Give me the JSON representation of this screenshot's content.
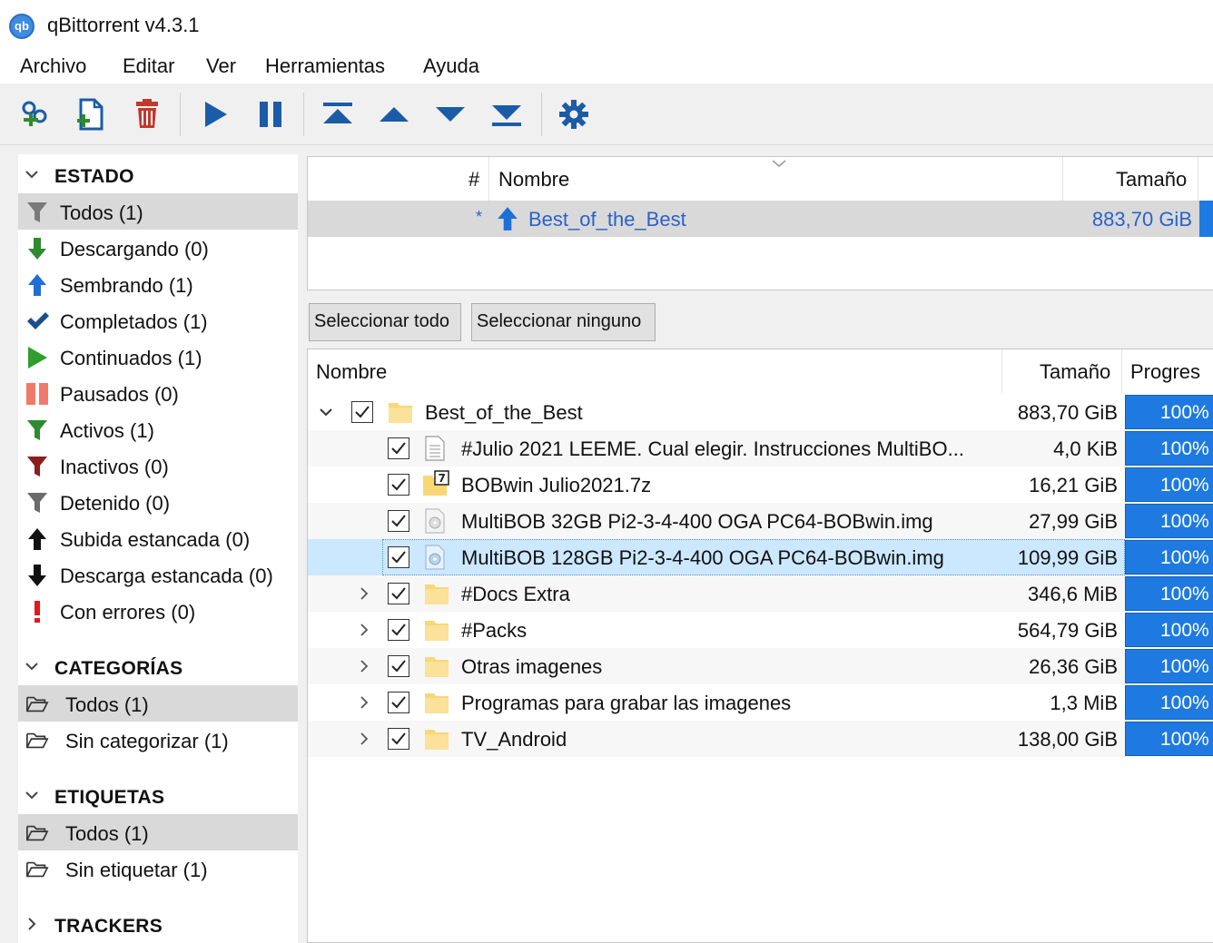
{
  "window": {
    "title": "qBittorrent v4.3.1",
    "logo_text": "qb"
  },
  "menu": [
    "Archivo",
    "Editar",
    "Ver",
    "Herramientas",
    "Ayuda"
  ],
  "toolbar": {
    "buttons": [
      "add-link-icon",
      "add-file-icon",
      "delete-icon",
      "resume-icon",
      "pause-icon",
      "move-top-icon",
      "move-up-icon",
      "move-down-icon",
      "move-bottom-icon",
      "settings-gear-icon"
    ],
    "colors": {
      "icon": "#1a5ca8",
      "delete": "#c0392b"
    }
  },
  "sidebar": {
    "estado": {
      "title": "ESTADO",
      "items": [
        {
          "label": "Todos (1)",
          "icon": "filter-icon",
          "selected": true
        },
        {
          "label": "Descargando (0)",
          "icon": "download-arrow-icon"
        },
        {
          "label": "Sembrando (1)",
          "icon": "upload-arrow-icon"
        },
        {
          "label": "Completados (1)",
          "icon": "checkmark-icon"
        },
        {
          "label": "Continuados (1)",
          "icon": "play-icon"
        },
        {
          "label": "Pausados (0)",
          "icon": "pause-icon"
        },
        {
          "label": "Activos (1)",
          "icon": "filter-green-icon"
        },
        {
          "label": "Inactivos (0)",
          "icon": "filter-red-icon"
        },
        {
          "label": "Detenido (0)",
          "icon": "filter-gray-icon"
        },
        {
          "label": "Subida estancada (0)",
          "icon": "up-arrow-black-icon"
        },
        {
          "label": "Descarga estancada (0)",
          "icon": "down-arrow-black-icon"
        },
        {
          "label": "Con errores (0)",
          "icon": "error-icon"
        }
      ]
    },
    "categorias": {
      "title": "CATEGORÍAS",
      "items": [
        {
          "label": "Todos (1)",
          "selected": true
        },
        {
          "label": "Sin categorizar (1)"
        }
      ]
    },
    "etiquetas": {
      "title": "ETIQUETAS",
      "items": [
        {
          "label": "Todos (1)",
          "selected": true
        },
        {
          "label": "Sin etiquetar (1)"
        }
      ]
    },
    "trackers": {
      "title": "TRACKERS"
    }
  },
  "torrent_list": {
    "headers": {
      "num": "#",
      "name": "Nombre",
      "size": "Tamaño"
    },
    "rows": [
      {
        "num": "*",
        "name": "Best_of_the_Best",
        "size": "883,70 GiB",
        "status_color": "#1a5ca8"
      }
    ]
  },
  "buttons": {
    "select_all": "Seleccionar todo",
    "select_none": "Seleccionar ninguno"
  },
  "file_tree": {
    "headers": {
      "name": "Nombre",
      "size": "Tamaño",
      "progress": "Progres"
    },
    "rows": [
      {
        "name": "Best_of_the_Best",
        "size": "883,70 GiB",
        "progress": "100%",
        "type": "folder",
        "expand": "expanded"
      },
      {
        "name": "#Julio 2021 LEEME. Cual elegir. Instrucciones MultiBO...",
        "size": "4,0 KiB",
        "progress": "100%",
        "type": "text-file"
      },
      {
        "name": "BOBwin Julio2021.7z",
        "size": "16,21 GiB",
        "progress": "100%",
        "type": "archive"
      },
      {
        "name": "MultiBOB 32GB Pi2-3-4-400 OGA PC64-BOBwin.img",
        "size": "27,99 GiB",
        "progress": "100%",
        "type": "disk-image"
      },
      {
        "name": "MultiBOB 128GB Pi2-3-4-400 OGA PC64-BOBwin.img",
        "size": "109,99 GiB",
        "progress": "100%",
        "type": "disk-image",
        "highlighted": true
      },
      {
        "name": "#Docs Extra",
        "size": "346,6 MiB",
        "progress": "100%",
        "type": "folder",
        "expand": "collapsed"
      },
      {
        "name": "#Packs",
        "size": "564,79 GiB",
        "progress": "100%",
        "type": "folder",
        "expand": "collapsed"
      },
      {
        "name": "Otras imagenes",
        "size": "26,36 GiB",
        "progress": "100%",
        "type": "folder",
        "expand": "collapsed"
      },
      {
        "name": "Programas para grabar las imagenes",
        "size": "1,3 MiB",
        "progress": "100%",
        "type": "folder",
        "expand": "collapsed"
      },
      {
        "name": "TV_Android",
        "size": "138,00 GiB",
        "progress": "100%",
        "type": "folder",
        "expand": "collapsed"
      }
    ]
  },
  "colors": {
    "progress": "#1e7ae0",
    "selection": "#cce8ff",
    "selected_row": "#d9d9d9",
    "link_blue": "#2a62c9"
  }
}
